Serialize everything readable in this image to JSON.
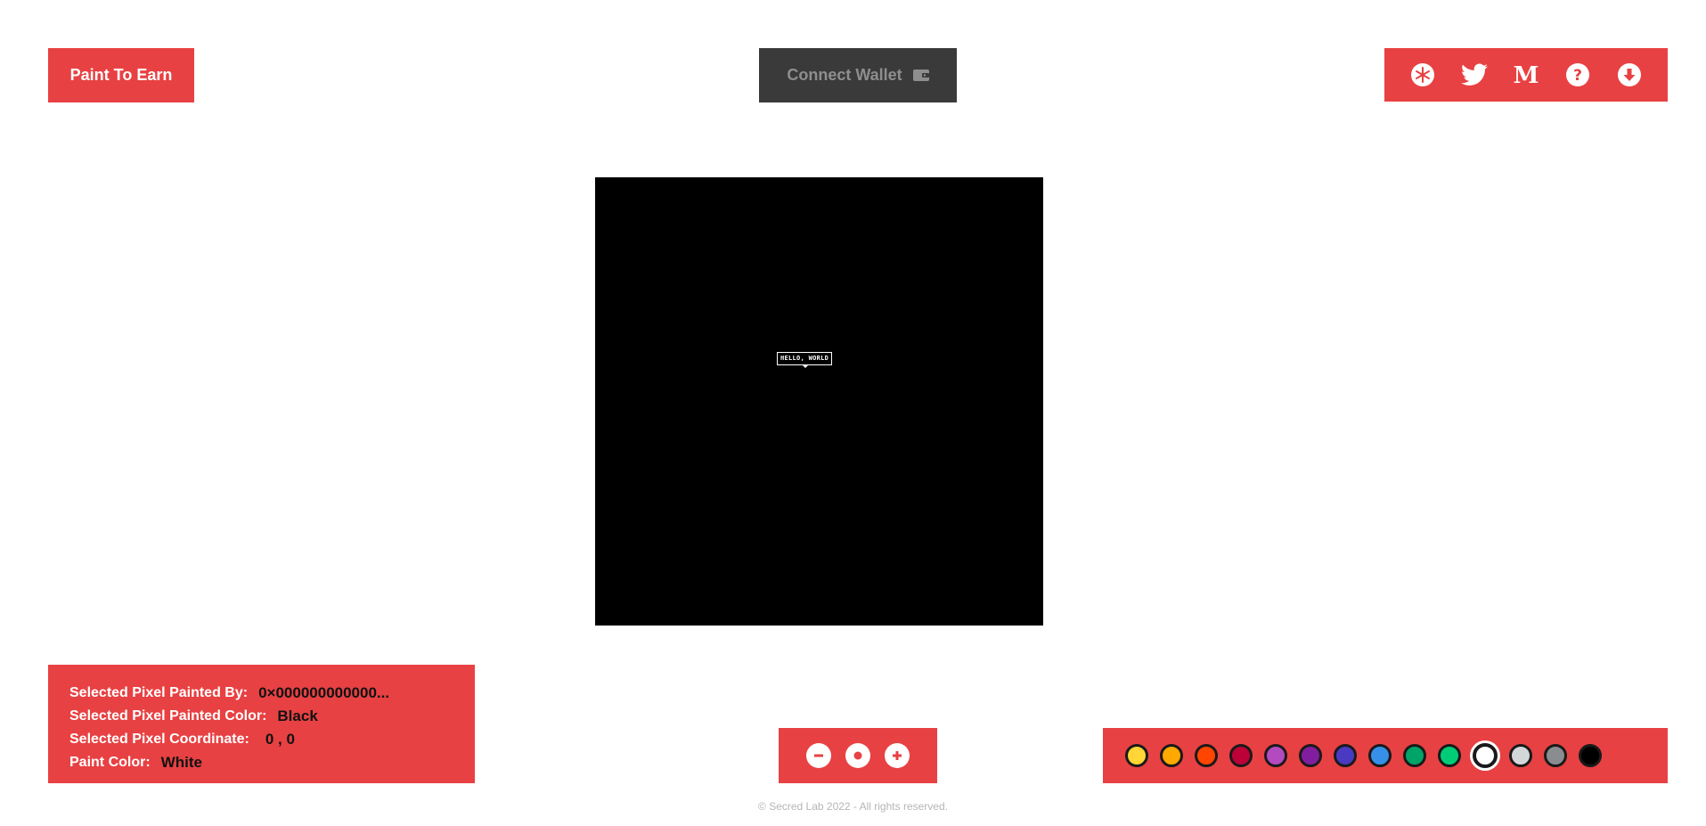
{
  "header": {
    "paint_to_earn": "Paint To Earn",
    "connect_wallet": "Connect Wallet"
  },
  "social_icons": [
    "snowflake-icon",
    "twitter-icon",
    "medium-icon",
    "help-icon",
    "download-icon"
  ],
  "canvas": {
    "background": "#000000",
    "label": "HELLO, WORLD"
  },
  "info": {
    "painted_by_label": "Selected Pixel Painted By:",
    "painted_by_value": "0×000000000000...",
    "painted_color_label": "Selected Pixel Painted Color:",
    "painted_color_value": "Black",
    "coordinate_label": "Selected Pixel Coordinate:",
    "coordinate_value": "0 , 0",
    "paint_color_label": "Paint Color:",
    "paint_color_value": "White"
  },
  "zoom": {
    "icons": [
      "zoom-out-icon",
      "zoom-reset-icon",
      "zoom-in-icon"
    ]
  },
  "palette": {
    "colors": [
      "#FFD635",
      "#FFA800",
      "#FF4500",
      "#BE0039",
      "#B44AC0",
      "#811E9F",
      "#493AC1",
      "#3690EA",
      "#00A368",
      "#00CC78",
      "#FFFFFF",
      "#D4D7D9",
      "#898D90",
      "#000000"
    ],
    "selected": "#FFFFFF"
  },
  "theme": {
    "accent": "#E84143",
    "wallet_bg": "#3A3A3A"
  },
  "footer": {
    "text": "© Secred Lab 2022 - All rights reserved."
  }
}
